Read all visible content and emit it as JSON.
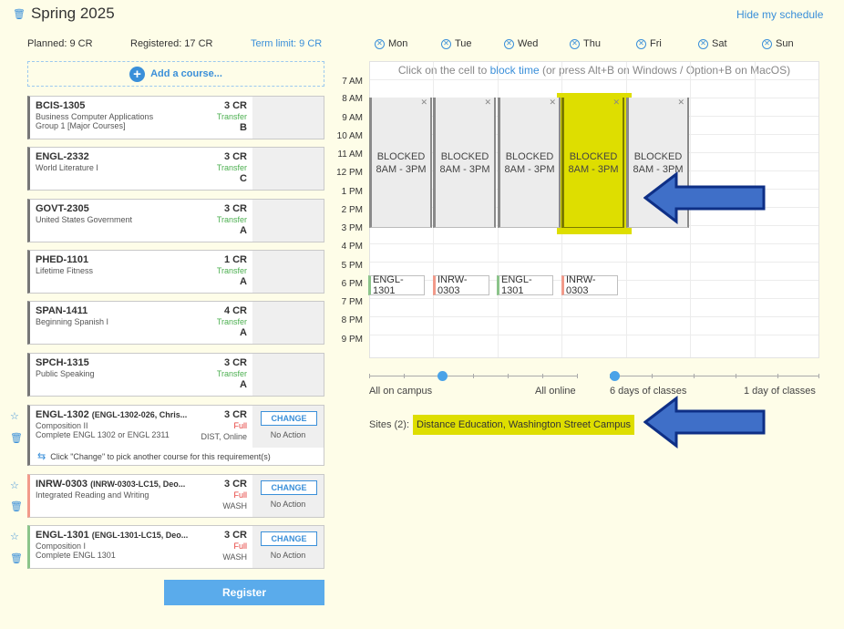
{
  "header": {
    "term_title": "Spring 2025",
    "hide_label": "Hide my schedule"
  },
  "summary": {
    "planned": "Planned: 9 CR",
    "registered": "Registered: 17 CR",
    "term_limit": "Term limit: 9 CR"
  },
  "add_course_label": "Add a course...",
  "courses": [
    {
      "code": "BCIS-1305",
      "section": "",
      "name": "Business Computer Applications",
      "sub": "Group 1 [Major Courses]",
      "credits": "3 CR",
      "status": "Transfer",
      "grade": "B"
    },
    {
      "code": "ENGL-2332",
      "section": "",
      "name": "World Literature I",
      "sub": "",
      "credits": "3 CR",
      "status": "Transfer",
      "grade": "C"
    },
    {
      "code": "GOVT-2305",
      "section": "",
      "name": "United States Government",
      "sub": "",
      "credits": "3 CR",
      "status": "Transfer",
      "grade": "A"
    },
    {
      "code": "PHED-1101",
      "section": "",
      "name": "Lifetime Fitness",
      "sub": "",
      "credits": "1 CR",
      "status": "Transfer",
      "grade": "A"
    },
    {
      "code": "SPAN-1411",
      "section": "",
      "name": "Beginning Spanish I",
      "sub": "",
      "credits": "4 CR",
      "status": "Transfer",
      "grade": "A"
    },
    {
      "code": "SPCH-1315",
      "section": "",
      "name": "Public Speaking",
      "sub": "",
      "credits": "3 CR",
      "status": "Transfer",
      "grade": "A"
    },
    {
      "code": "ENGL-1302",
      "section": "(ENGL-1302-026, Chris...",
      "name": "Composition II",
      "sub": "Complete ENGL 1302 or ENGL 2311",
      "credits": "3 CR",
      "status": "Full",
      "location": "DIST, Online",
      "change": "CHANGE",
      "action": "No Action"
    },
    {
      "code": "INRW-0303",
      "section": "(INRW-0303-LC15, Deo...",
      "name": "Integrated Reading and Writing",
      "sub": "",
      "credits": "3 CR",
      "status": "Full",
      "location": "WASH",
      "change": "CHANGE",
      "action": "No Action"
    },
    {
      "code": "ENGL-1301",
      "section": "(ENGL-1301-LC15, Deo...",
      "name": "Composition I",
      "sub": "Complete ENGL 1301",
      "credits": "3 CR",
      "status": "Full",
      "location": "WASH",
      "change": "CHANGE",
      "action": "No Action"
    }
  ],
  "change_note": "Click \"Change\" to pick another course for this requirement(s)",
  "register_label": "Register",
  "days": [
    "Mon",
    "Tue",
    "Wed",
    "Thu",
    "Fri",
    "Sat",
    "Sun"
  ],
  "grid": {
    "hint_prefix": "Click on the cell to ",
    "hint_link": "block time",
    "hint_suffix": " (or press Alt+B on Windows / Option+B on MacOS)",
    "times": [
      "7 AM",
      "8 AM",
      "9 AM",
      "10 AM",
      "11 AM",
      "12 PM",
      "1 PM",
      "2 PM",
      "3 PM",
      "4 PM",
      "5 PM",
      "6 PM",
      "7 PM",
      "8 PM",
      "9 PM"
    ],
    "blocks": [
      {
        "line1": "BLOCKED",
        "line2": "8AM - 3PM"
      },
      {
        "line1": "BLOCKED",
        "line2": "8AM - 3PM"
      },
      {
        "line1": "BLOCKED",
        "line2": "8AM - 3PM"
      },
      {
        "line1": "BLOCKED",
        "line2": "8AM - 3PM"
      },
      {
        "line1": "BLOCKED",
        "line2": "8AM - 3PM"
      }
    ],
    "sections": [
      {
        "label": "ENGL-1301",
        "color": "#8bc48a"
      },
      {
        "label": "INRW-0303",
        "color": "#f29a8a"
      },
      {
        "label": "ENGL-1301",
        "color": "#8bc48a"
      },
      {
        "label": "INRW-0303",
        "color": "#f29a8a"
      }
    ]
  },
  "sliders": {
    "campus_left": "All on campus",
    "campus_right": "All online",
    "days_left": "6 days of classes",
    "days_right": "1 day of classes"
  },
  "sites": {
    "label": "Sites (2):",
    "value": "Distance Education, Washington Street Campus"
  },
  "colors": {
    "accent": "#3a8fd9",
    "highlight": "#dede00",
    "arrow": "#3f6fc8",
    "transfer": "#4caf50",
    "full": "#e53935"
  }
}
